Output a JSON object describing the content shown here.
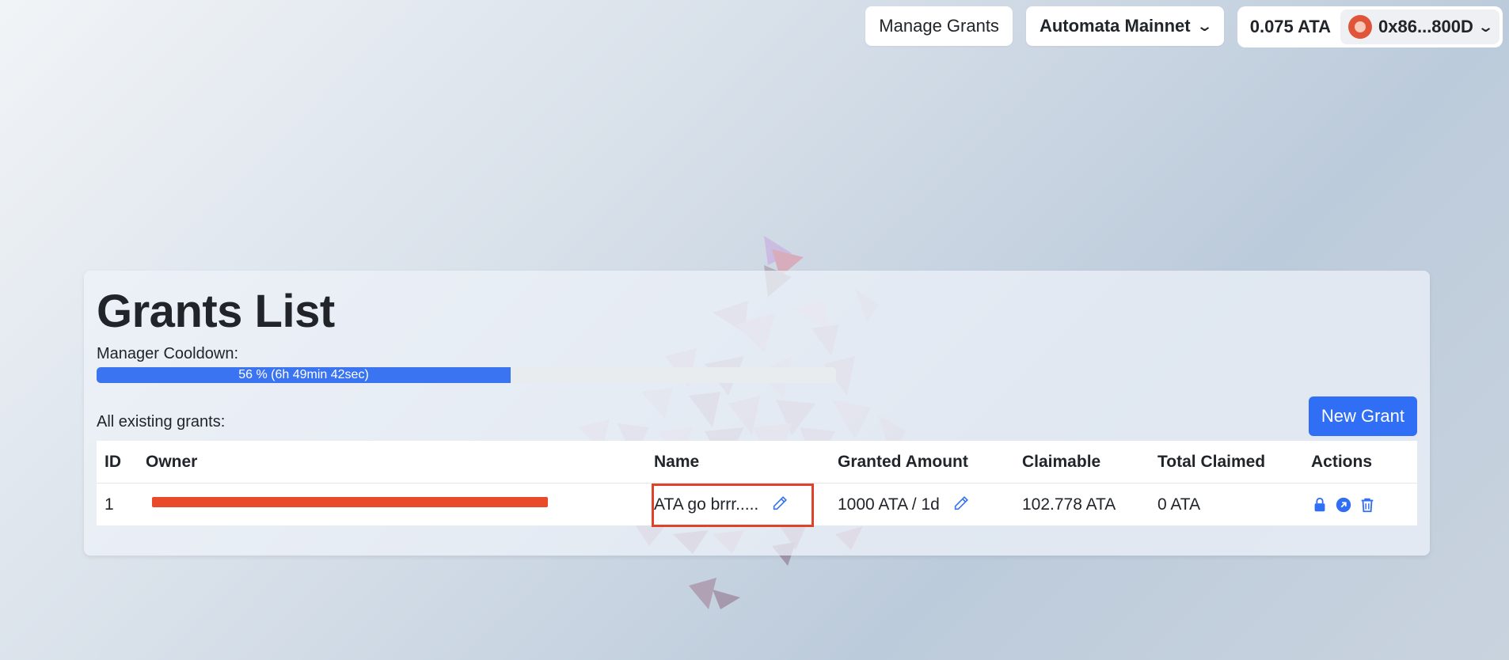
{
  "topbar": {
    "manage_grants": "Manage Grants",
    "network": "Automata Mainnet",
    "balance": "0.075 ATA",
    "address": "0x86...800D"
  },
  "panel": {
    "title": "Grants List",
    "cooldown_label": "Manager Cooldown:",
    "cooldown_progress_text": "56 % (6h 49min 42sec)",
    "cooldown_progress_percent": 56,
    "existing_label": "All existing grants:",
    "new_grant_button": "New Grant"
  },
  "table": {
    "headers": [
      "ID",
      "Owner",
      "Name",
      "Granted Amount",
      "Claimable",
      "Total Claimed",
      "Actions"
    ],
    "rows": [
      {
        "id": "1",
        "name": "ATA go brrr.....",
        "granted_amount": "1000 ATA / 1d",
        "claimable": "102.778 ATA",
        "total_claimed": "0 ATA"
      }
    ]
  },
  "colors": {
    "accent": "#2f6ef5",
    "progress": "#3a74f0",
    "highlight_box": "#e0412a",
    "redaction": "#e84a2a"
  },
  "icons": {
    "edit": "pencil-icon",
    "lock": "lock-icon",
    "open": "arrow-up-right-circle-icon",
    "delete": "trash-icon",
    "chevron": "chevron-down-icon"
  }
}
